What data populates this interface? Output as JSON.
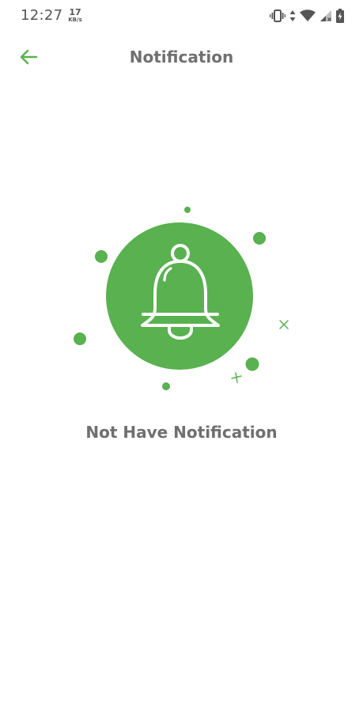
{
  "status_bar": {
    "time": "12:27",
    "net_speed": "17",
    "net_speed_unit": "KB/s",
    "icons": [
      "vibrate-icon",
      "data-arrows-icon",
      "wifi-icon",
      "signal-icon",
      "battery-charging-icon"
    ]
  },
  "header": {
    "title": "Notification",
    "back_icon": "arrow-left-icon"
  },
  "empty_state": {
    "icon": "bell-icon",
    "message": "Not Have Notification"
  },
  "colors": {
    "accent": "#59b14f",
    "title_text": "#707070",
    "status_text": "#555555"
  }
}
